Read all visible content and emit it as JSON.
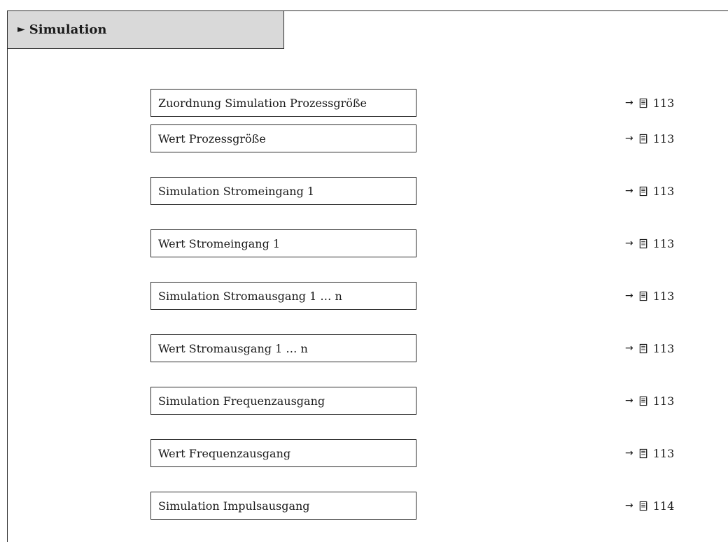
{
  "section": {
    "marker": "►",
    "title": "Simulation"
  },
  "items": [
    {
      "label": "Zuordnung Simulation Prozessgröße",
      "arrow": "→",
      "page": "113"
    },
    {
      "label": "Wert Prozessgröße",
      "arrow": "→",
      "page": "113"
    },
    {
      "label": "Simulation Stromeingang 1",
      "arrow": "→",
      "page": "113"
    },
    {
      "label": "Wert Stromeingang 1",
      "arrow": "→",
      "page": "113"
    },
    {
      "label": "Simulation Stromausgang 1 … n",
      "arrow": "→",
      "page": "113"
    },
    {
      "label": "Wert Stromausgang 1 … n",
      "arrow": "→",
      "page": "113"
    },
    {
      "label": "Simulation Frequenzausgang",
      "arrow": "→",
      "page": "113"
    },
    {
      "label": "Wert Frequenzausgang",
      "arrow": "→",
      "page": "113"
    },
    {
      "label": "Simulation Impulsausgang",
      "arrow": "→",
      "page": "114"
    }
  ]
}
